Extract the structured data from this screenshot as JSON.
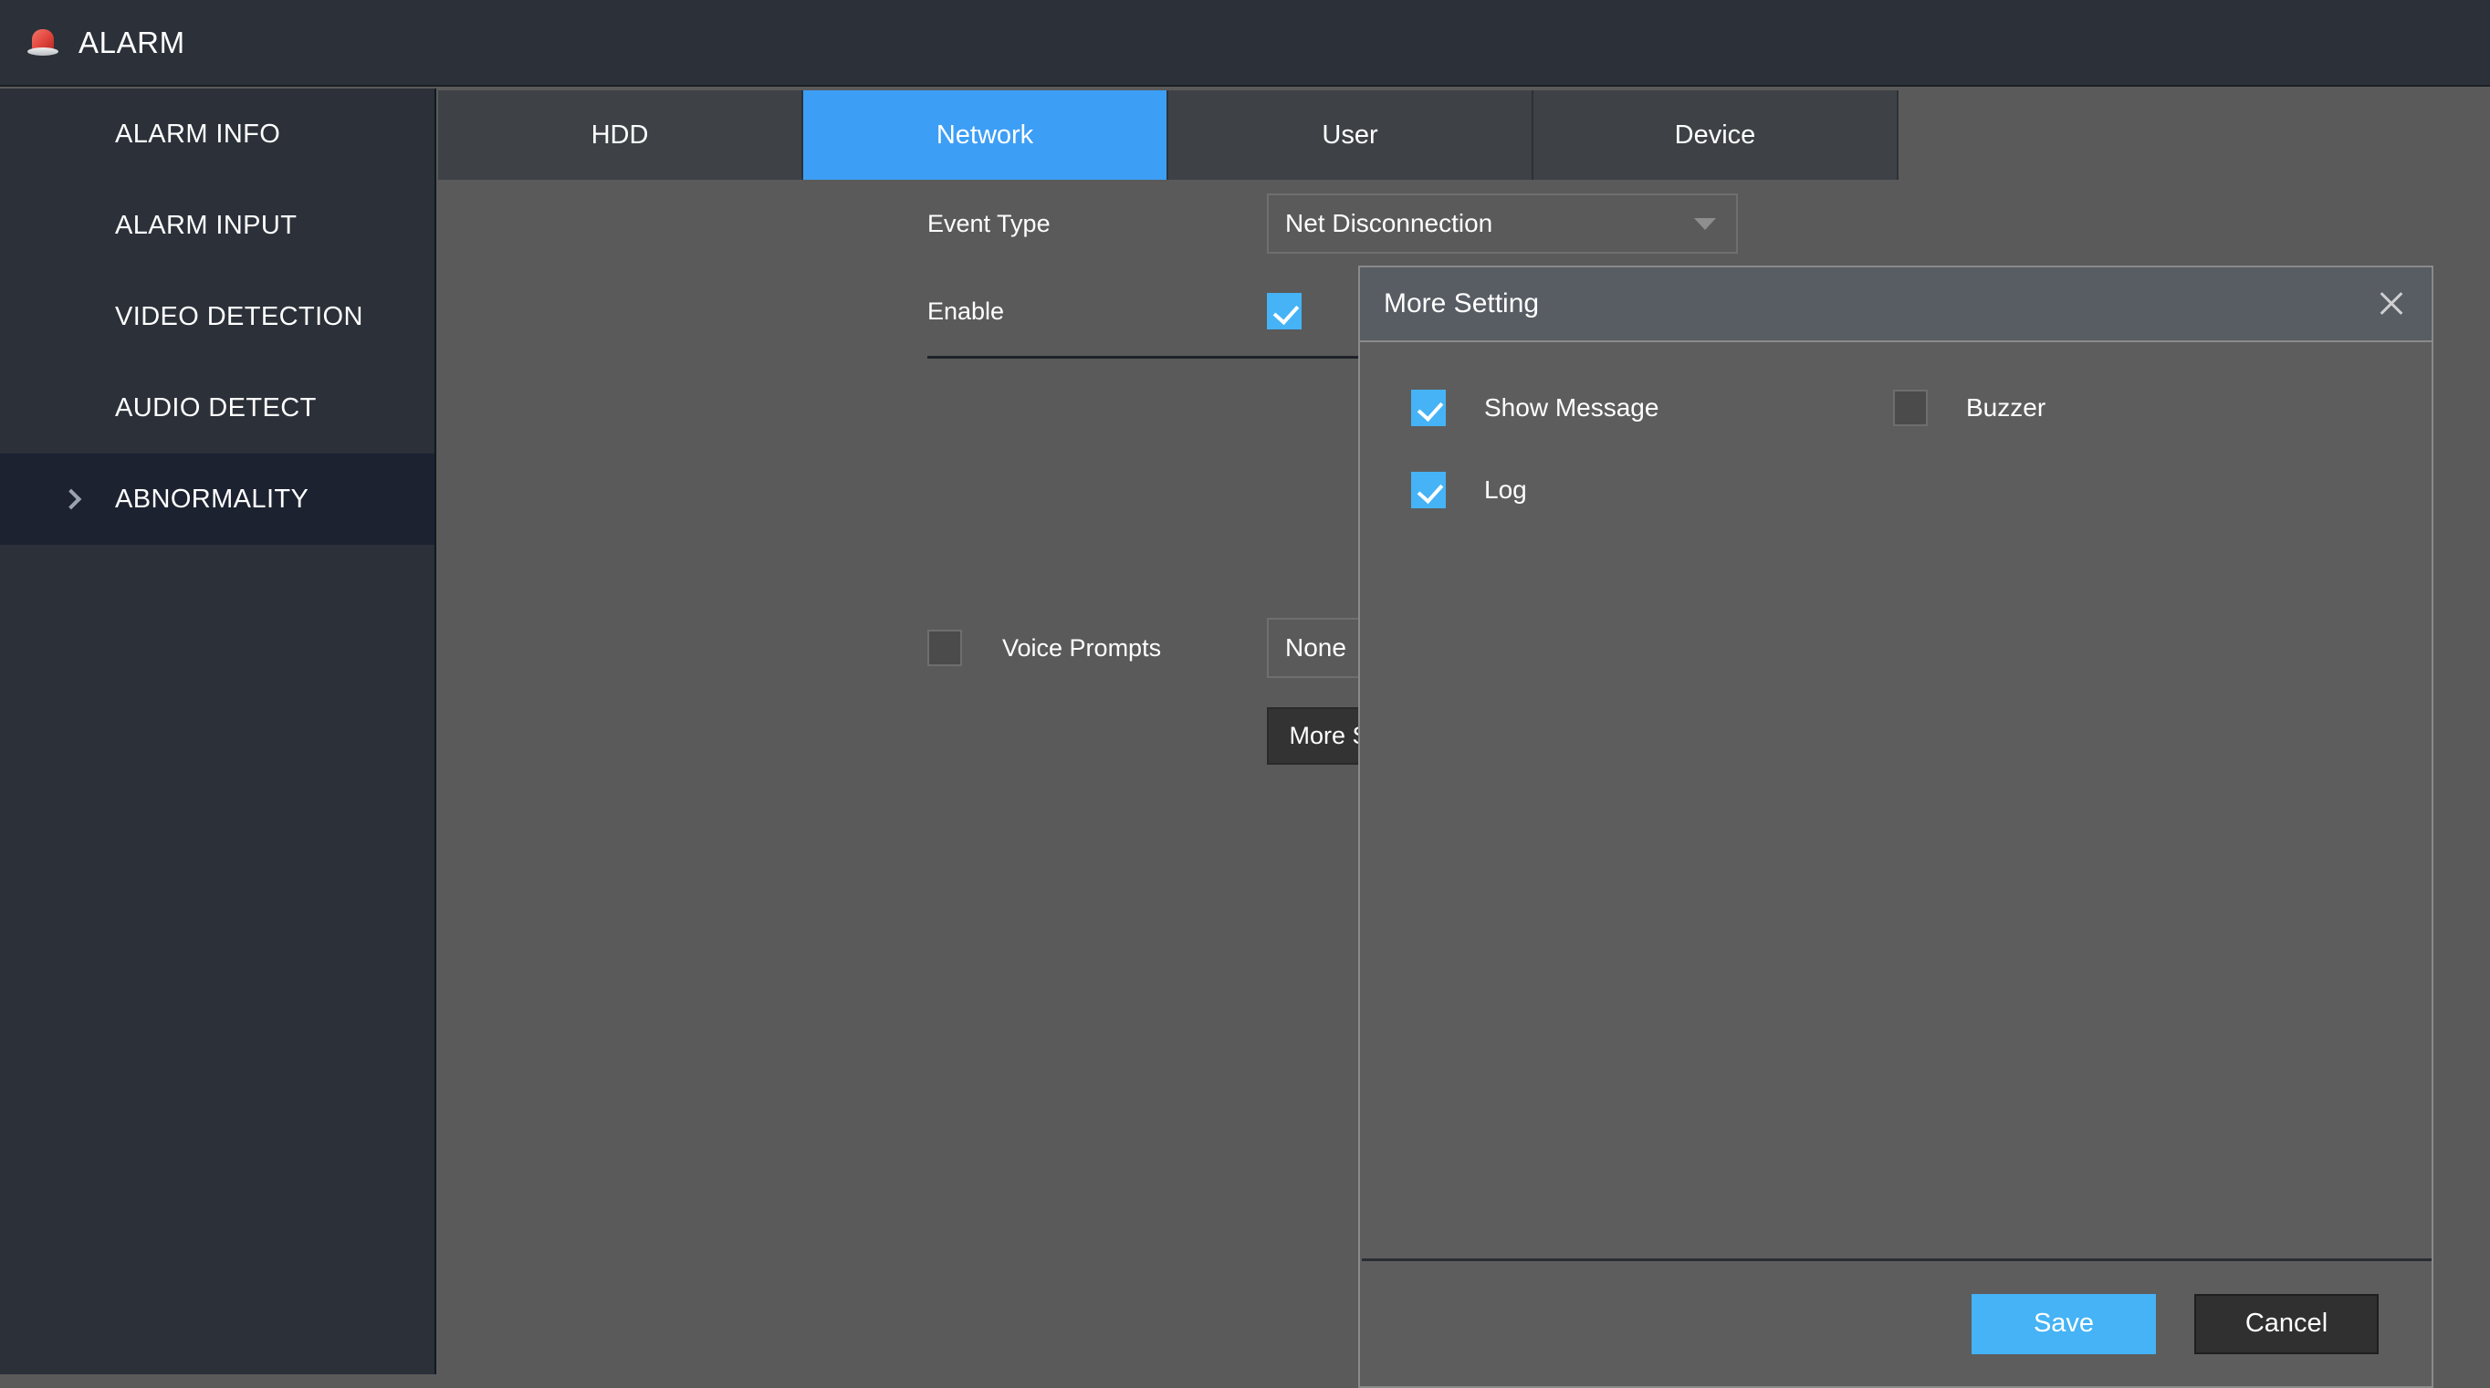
{
  "header": {
    "title": "ALARM",
    "icon": "alarm-light-icon"
  },
  "sidebar": {
    "items": [
      {
        "label": "ALARM INFO",
        "selected": false
      },
      {
        "label": "ALARM INPUT",
        "selected": false
      },
      {
        "label": "VIDEO DETECTION",
        "selected": false
      },
      {
        "label": "AUDIO DETECT",
        "selected": false
      },
      {
        "label": "ABNORMALITY",
        "selected": true
      }
    ]
  },
  "tabs": [
    {
      "label": "HDD",
      "active": false
    },
    {
      "label": "Network",
      "active": true
    },
    {
      "label": "User",
      "active": false
    },
    {
      "label": "Device",
      "active": false
    }
  ],
  "form": {
    "event_type_label": "Event Type",
    "event_type_value": "Net Disconnection",
    "enable_label": "Enable",
    "enable_checked": true,
    "voice_prompts_label": "Voice Prompts",
    "voice_prompts_checked": false,
    "voice_prompts_value": "None",
    "more_setting_button": "More Setting"
  },
  "dialog": {
    "title": "More Setting",
    "close_icon": "close-icon",
    "checkboxes": [
      {
        "label": "Show Message",
        "checked": true
      },
      {
        "label": "Buzzer",
        "checked": false
      },
      {
        "label": "Log",
        "checked": true
      }
    ],
    "save_label": "Save",
    "cancel_label": "Cancel"
  },
  "colors": {
    "accent": "#3d9ef5",
    "checkbox_on": "#45b3f5",
    "panel_bg": "#5a5a5a",
    "sidebar_bg": "#2b3039",
    "sidebar_selected": "#1c2230",
    "dialog_bg": "#5d5d5d"
  }
}
